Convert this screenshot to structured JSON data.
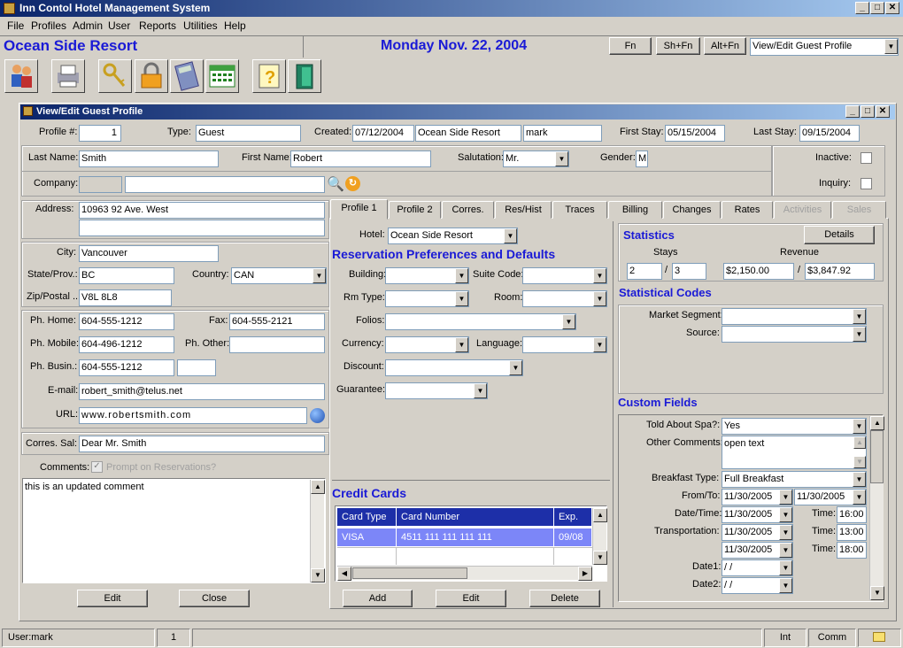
{
  "app": {
    "title": "Inn Contol Hotel Management System",
    "menu": [
      "File",
      "Profiles",
      "Admin",
      "User",
      "Reports",
      "Utilities",
      "Help"
    ],
    "property": "Ocean Side Resort",
    "date": "Monday Nov. 22, 2004",
    "fn_buttons": [
      "Fn",
      "Sh+Fn",
      "Alt+Fn"
    ],
    "screen_select": "View/Edit Guest Profile"
  },
  "dialog": {
    "title": "View/Edit Guest Profile",
    "labels": {
      "profile_no": "Profile #:",
      "type": "Type:",
      "created": "Created:",
      "first_stay": "First Stay:",
      "last_stay": "Last Stay:",
      "last_name": "Last Name:",
      "first_name": "First Name:",
      "salutation": "Salutation:",
      "gender": "Gender:",
      "inactive": "Inactive:",
      "inquiry": "Inquiry:",
      "company": "Company:",
      "address": "Address:",
      "city": "City:",
      "state": "State/Prov.:",
      "country": "Country:",
      "zip": "Zip/Postal ...",
      "ph_home": "Ph. Home:",
      "fax": "Fax:",
      "ph_mobile": "Ph. Mobile:",
      "ph_other": "Ph. Other:",
      "ph_busin": "Ph. Busin.:",
      "email": "E-mail:",
      "url": "URL:",
      "corres_sal": "Corres. Sal:",
      "comments": "Comments:",
      "prompt_res": "Prompt on Reservations?"
    },
    "values": {
      "profile_no": "1",
      "type": "Guest",
      "created_date": "07/12/2004",
      "created_property": "Ocean Side Resort",
      "created_user": "mark",
      "first_stay": "05/15/2004",
      "last_stay": "09/15/2004",
      "last_name": "Smith",
      "first_name": "Robert",
      "salutation": "Mr.",
      "gender": "M",
      "address1": "10963 92 Ave. West",
      "city": "Vancouver",
      "state": "BC",
      "country": "CAN",
      "zip": "V8L 8L8",
      "ph_home": "604-555-1212",
      "fax": "604-555-2121",
      "ph_mobile": "604-496-1212",
      "ph_busin": "604-555-1212",
      "email": "robert_smith@telus.net",
      "url": "www.robertsmith.com",
      "corres_sal": "Dear Mr. Smith",
      "comment_text": "this is an updated comment"
    },
    "buttons": {
      "edit": "Edit",
      "close": "Close"
    },
    "tabs": [
      "Profile 1",
      "Profile 2",
      "Corres.",
      "Res/Hist",
      "Traces",
      "Billing",
      "Changes",
      "Rates",
      "Activities",
      "Sales"
    ],
    "profile1": {
      "hotel_label": "Hotel:",
      "hotel_value": "Ocean Side Resort",
      "res_prefs_title": "Reservation Preferences and Defaults",
      "labels": {
        "building": "Building:",
        "suite_code": "Suite Code:",
        "rm_type": "Rm Type:",
        "room": "Room:",
        "folios": "Folios:",
        "currency": "Currency:",
        "language": "Language:",
        "discount": "Discount:",
        "guarantee": "Guarantee:"
      },
      "credit_cards_title": "Credit Cards",
      "cc_headers": [
        "Card Type",
        "Card Number",
        "Exp."
      ],
      "cc_row": [
        "VISA",
        "4511 111 111 111 111",
        "09/08"
      ],
      "cc_buttons": {
        "add": "Add",
        "edit": "Edit",
        "delete": "Delete"
      },
      "statistics": {
        "title": "Statistics",
        "details": "Details",
        "stays_label": "Stays",
        "revenue_label": "Revenue",
        "stays_a": "2",
        "stays_b": "3",
        "revenue_a": "$2,150.00",
        "revenue_b": "$3,847.92",
        "sep": "/"
      },
      "stat_codes": {
        "title": "Statistical Codes",
        "market_segment": "Market Segment:",
        "source": "Source:"
      },
      "custom_fields": {
        "title": "Custom Fields",
        "told_spa_label": "Told About Spa?:",
        "told_spa_value": "Yes",
        "other_comments_label": "Other Comments:",
        "other_comments_value": "open text",
        "breakfast_label": "Breakfast Type:",
        "breakfast_value": "Full Breakfast",
        "from_to_label": "From/To:",
        "from_value": "11/30/2005",
        "to_value": "11/30/2005",
        "datetime_label": "Date/Time:",
        "datetime_value": "11/30/2005",
        "time_label": "Time:",
        "time1": "16:00",
        "transport_label": "Transportation:",
        "transport_date": "11/30/2005",
        "time2": "13:00",
        "extra_date": "11/30/2005",
        "time3": "18:00",
        "date1_label": "Date1:",
        "date1_value": " / /",
        "date2_label": "Date2:",
        "date2_value": " / /"
      }
    }
  },
  "status": {
    "user": "User:mark",
    "count": "1",
    "int": "Int",
    "comm": "Comm"
  }
}
